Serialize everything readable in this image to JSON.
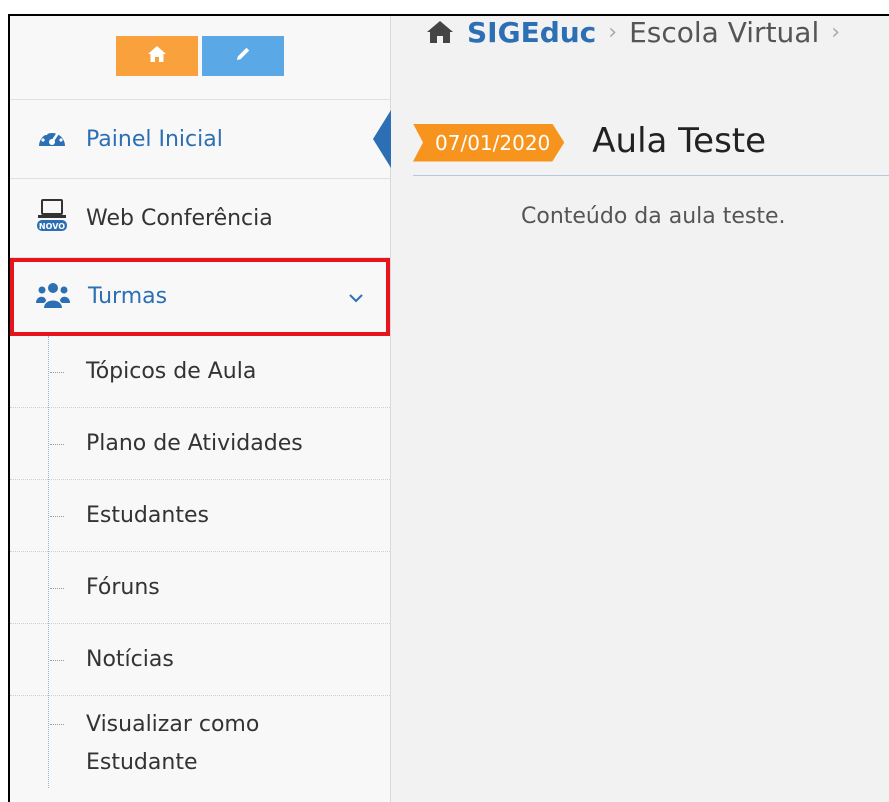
{
  "shortcuts": {
    "home_icon": "home-icon",
    "edit_icon": "pencil-icon",
    "home_color": "#f8a13d",
    "edit_color": "#5aa9e6"
  },
  "sidebar": {
    "items": [
      {
        "label": "Painel Inicial",
        "icon": "dashboard-icon",
        "active": true
      },
      {
        "label": "Web Conferência",
        "icon": "laptop-icon",
        "badge": "NOVO"
      },
      {
        "label": "Turmas",
        "icon": "users-icon",
        "expanded": true
      }
    ],
    "submenu": [
      {
        "label": "Tópicos de Aula"
      },
      {
        "label": "Plano de Atividades"
      },
      {
        "label": "Estudantes"
      },
      {
        "label": "Fóruns"
      },
      {
        "label": "Notícias"
      },
      {
        "label_line1": "Visualizar como",
        "label_line2": "Estudante"
      }
    ]
  },
  "breadcrumb": {
    "root": "SIGEduc",
    "separator": "›",
    "current": "Escola Virtual"
  },
  "lesson": {
    "date": "07/01/2020",
    "title": "Aula Teste",
    "content": "Conteúdo da aula teste."
  },
  "colors": {
    "accent": "#2c6fb4",
    "badge": "#f7941d",
    "highlight_box": "#e8141c"
  }
}
